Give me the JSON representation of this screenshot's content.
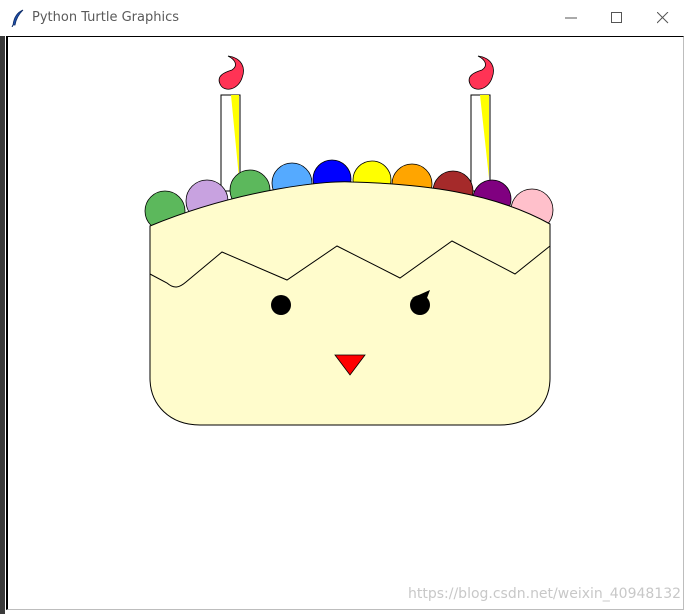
{
  "window": {
    "title": "Python Turtle Graphics",
    "icon": "feather-icon",
    "controls": {
      "minimize": "minimize-icon",
      "maximize": "maximize-icon",
      "close": "close-icon"
    }
  },
  "canvas": {
    "background": "#ffffff",
    "cake": {
      "body_color": "#fffccc",
      "outline_color": "#000000",
      "eye_color": "#000000",
      "beak_color": "#ff0000",
      "candle_color": "#ffffff",
      "candle_stripe_color": "#ffff00",
      "flame_color": "#ff3355",
      "cream_balls": [
        "#5cb85c",
        "#c8a2e0",
        "#5cb85c",
        "#55aaff",
        "#0000ff",
        "#ffff00",
        "#ffa500",
        "#a52a2a",
        "#800080",
        "#ffc0cb"
      ]
    }
  },
  "watermark": "https://blog.csdn.net/weixin_40948132"
}
